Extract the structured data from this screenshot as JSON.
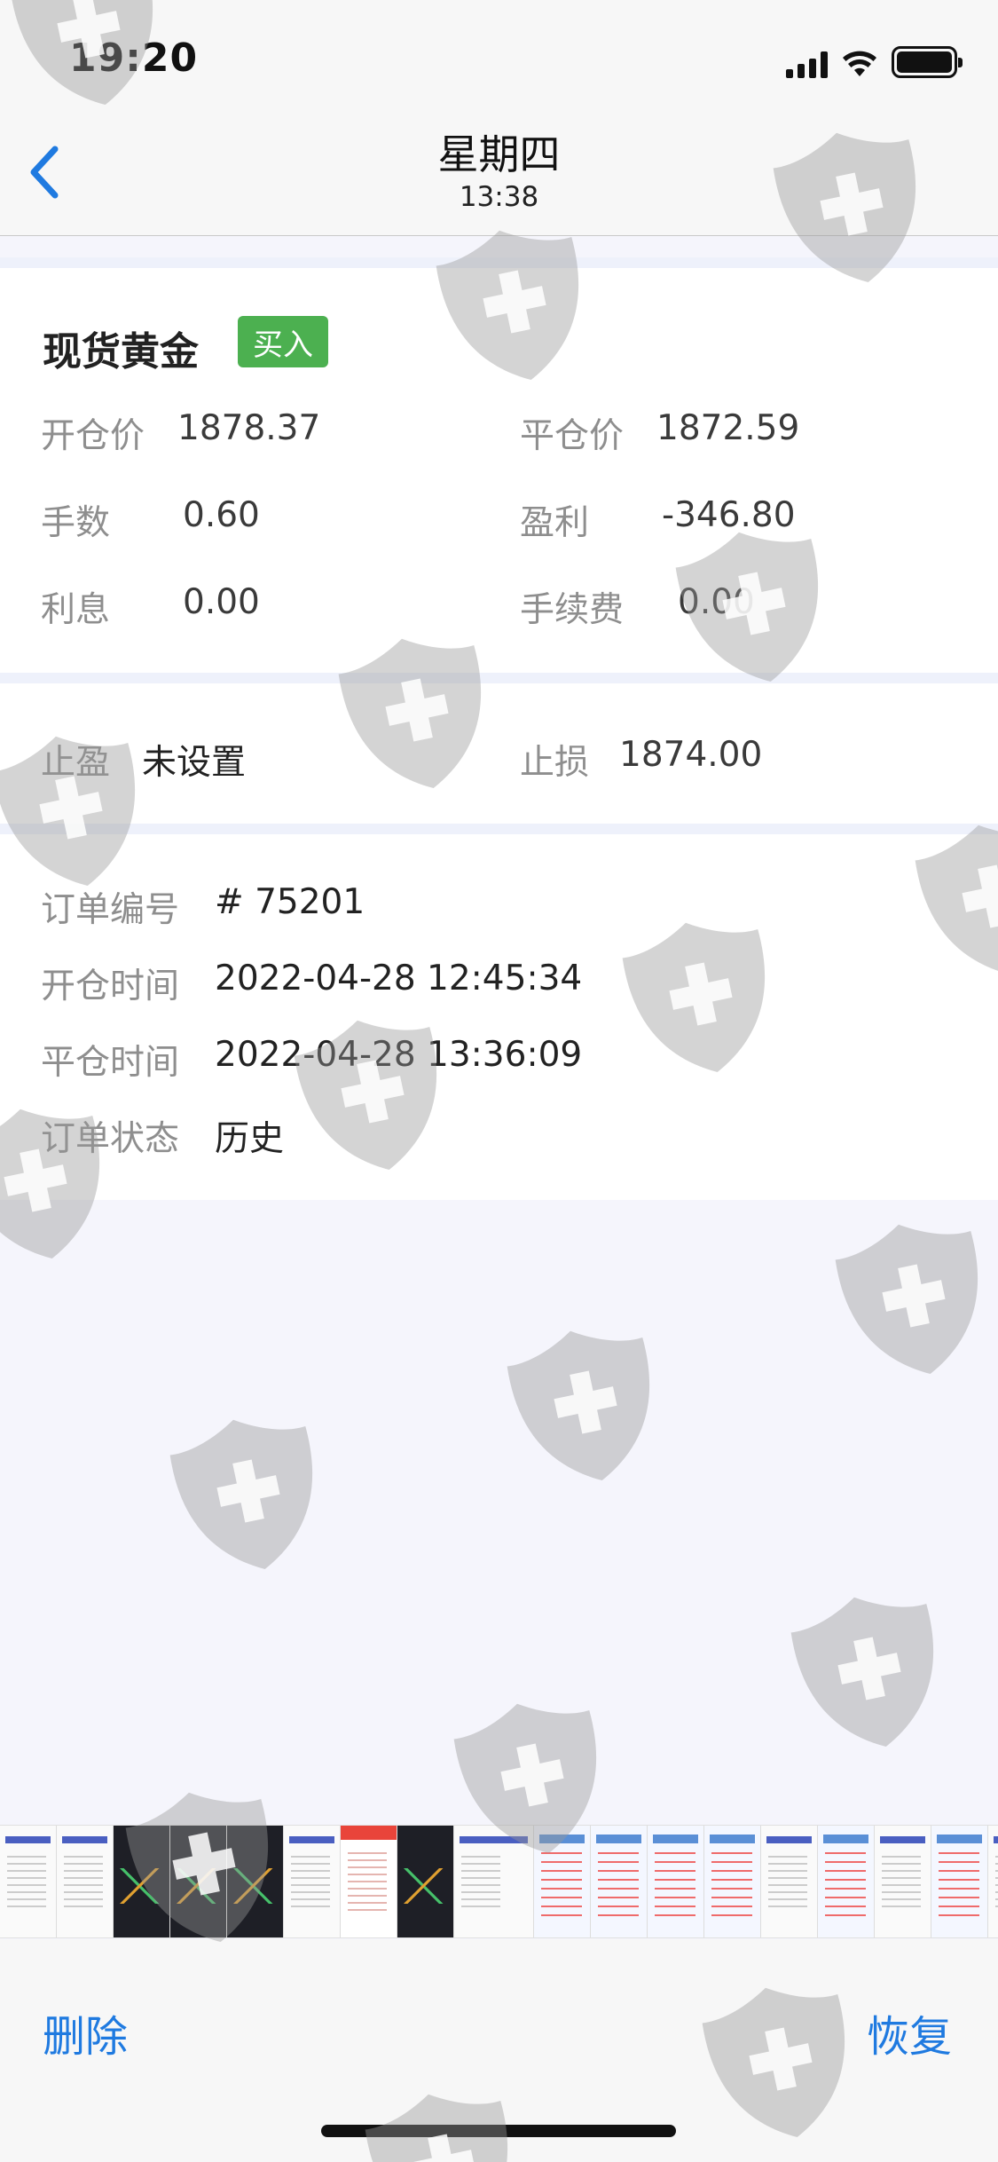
{
  "status_bar": {
    "time": "19:20"
  },
  "nav": {
    "title": "星期四",
    "subtitle": "13:38"
  },
  "order": {
    "product": "现货黄金",
    "direction": "买入",
    "open_price": {
      "label": "开仓价",
      "value": "1878.37"
    },
    "close_price": {
      "label": "平仓价",
      "value": "1872.59"
    },
    "lots": {
      "label": "手数",
      "value": "0.60"
    },
    "profit": {
      "label": "盈利",
      "value": "-346.80"
    },
    "interest": {
      "label": "利息",
      "value": "0.00"
    },
    "fee": {
      "label": "手续费",
      "value": "0.00"
    },
    "take_profit": {
      "label": "止盈",
      "value": "未设置"
    },
    "stop_loss": {
      "label": "止损",
      "value": "1874.00"
    },
    "order_no": {
      "label": "订单编号",
      "value": "# 75201"
    },
    "open_time": {
      "label": "开仓时间",
      "value": "2022-04-28 12:45:34"
    },
    "close_time": {
      "label": "平仓时间",
      "value": "2022-04-28 13:36:09"
    },
    "status": {
      "label": "订单状态",
      "value": "历史"
    }
  },
  "toolbar": {
    "delete": "删除",
    "restore": "恢复"
  },
  "colors": {
    "accent": "#1f7ae0",
    "buy_tag": "#4cb050"
  },
  "icons": {
    "back": "chevron-left-icon",
    "watermark": "shield-plus-icon"
  }
}
